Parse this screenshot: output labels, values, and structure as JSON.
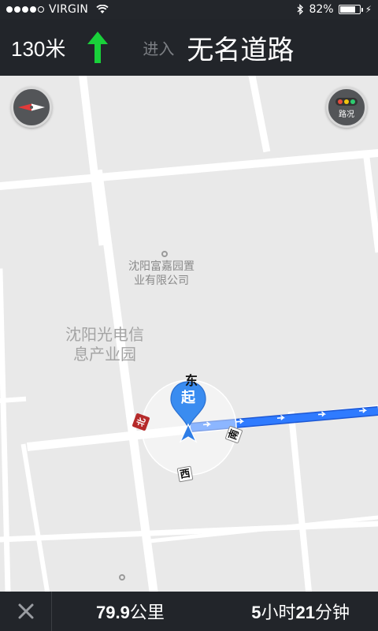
{
  "status_bar": {
    "carrier": "VIRGIN",
    "battery_text": "82%",
    "battery_level": 0.82
  },
  "guidance": {
    "distance": "130米",
    "enter_label": "进入",
    "road_name": "无名道路",
    "turn_icon": "straight-arrow-icon",
    "turn_color": "#19d13a"
  },
  "map": {
    "poi_label_line1": "沈阳富嘉园置",
    "poi_label_line2": "业有限公司",
    "area_label_line1": "沈阳光电信",
    "area_label_line2": "息产业园",
    "traffic_button_label": "路况",
    "start_marker_label": "起",
    "direction_east": "东",
    "direction_south": "南",
    "direction_west": "西",
    "direction_north": "北",
    "route_color": "#2f7bff",
    "marker_color": "#3a8cf0"
  },
  "trip": {
    "distance_value": "79.9",
    "distance_unit": "公里",
    "time_hours": "5",
    "time_hours_unit": "小时",
    "time_minutes": "21",
    "time_minutes_unit": "分钟"
  }
}
